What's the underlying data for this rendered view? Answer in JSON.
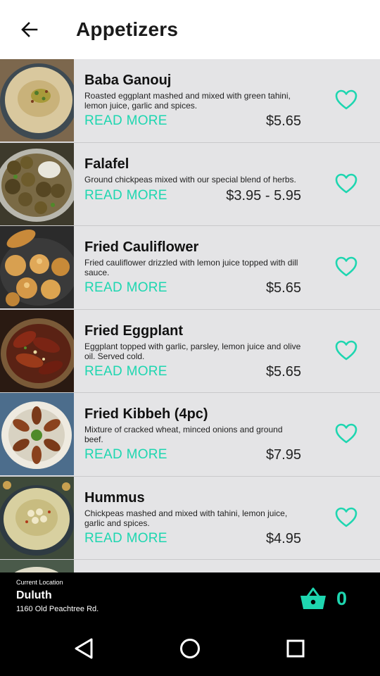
{
  "header": {
    "title": "Appetizers",
    "back_icon": "arrow-left-icon"
  },
  "items": [
    {
      "name": "Baba Ganouj",
      "description": "Roasted eggplant mashed and mixed with green tahini, lemon juice, garlic and spices.",
      "read_more": "READ MORE",
      "price": "$5.65"
    },
    {
      "name": "Falafel",
      "description": "Ground chickpeas mixed with our special blend of herbs.",
      "read_more": "READ MORE",
      "price": "$3.95 - 5.95"
    },
    {
      "name": "Fried Cauliflower",
      "description": "Fried cauliflower drizzled with lemon juice topped with dill sauce.",
      "read_more": "READ MORE",
      "price": "$5.65"
    },
    {
      "name": "Fried Eggplant",
      "description": "Eggplant topped with garlic, parsley, lemon juice and olive oil. Served cold.",
      "read_more": "READ MORE",
      "price": "$5.65"
    },
    {
      "name": "Fried Kibbeh (4pc)",
      "description": "Mixture of cracked wheat, minced onions and ground beef.",
      "read_more": "READ MORE",
      "price": "$7.95"
    },
    {
      "name": "Hummus",
      "description": "Chickpeas mashed and mixed with tahini, lemon juice, garlic and spices.",
      "read_more": "READ MORE",
      "price": "$4.95"
    }
  ],
  "location": {
    "caption": "Current Location",
    "city": "Duluth",
    "address": "1160 Old Peachtree Rd."
  },
  "cart": {
    "count": "0",
    "icon": "shopping-basket-icon"
  },
  "colors": {
    "accent": "#1ed6b0",
    "list_background": "#e4e4e6",
    "bottom_bar": "#000000"
  },
  "icons": {
    "favorite": "heart-outline-icon",
    "nav_back": "triangle-back-icon",
    "nav_home": "circle-home-icon",
    "nav_recents": "square-recents-icon"
  }
}
